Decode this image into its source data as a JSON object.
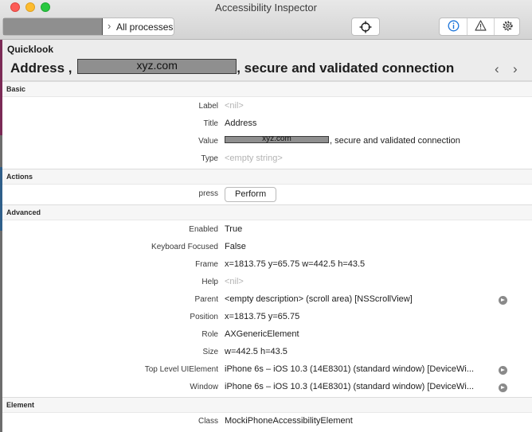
{
  "window": {
    "title": "Accessibility Inspector"
  },
  "toolbar": {
    "target_label": "All processes",
    "crosshair_icon": "crosshair-icon",
    "segments": [
      "info-icon",
      "warning-icon",
      "gear-icon"
    ]
  },
  "quicklook": {
    "heading": "Quicklook",
    "prefix": "Address ,",
    "redacted_text": "xyz.com",
    "suffix": ", secure and validated connection"
  },
  "sections": {
    "basic": "Basic",
    "actions": "Actions",
    "advanced": "Advanced",
    "element": "Element"
  },
  "basic": {
    "label_key": "Label",
    "label_val": "<nil>",
    "title_key": "Title",
    "title_val": "Address",
    "value_key": "Value",
    "value_redacted": "xyz.com",
    "value_suffix": ", secure and validated connection",
    "type_key": "Type",
    "type_val": "<empty string>"
  },
  "actions": {
    "press_key": "press",
    "perform_label": "Perform"
  },
  "advanced": {
    "enabled_key": "Enabled",
    "enabled_val": "True",
    "focused_key": "Keyboard Focused",
    "focused_val": "False",
    "frame_key": "Frame",
    "frame_val": "x=1813.75 y=65.75 w=442.5 h=43.5",
    "help_key": "Help",
    "help_val": "<nil>",
    "parent_key": "Parent",
    "parent_val": "<empty description> (scroll area) [NSScrollView]",
    "position_key": "Position",
    "position_val": "x=1813.75 y=65.75",
    "role_key": "Role",
    "role_val": "AXGenericElement",
    "size_key": "Size",
    "size_val": "w=442.5 h=43.5",
    "toplevel_key": "Top Level UIElement",
    "toplevel_val": "iPhone 6s – iOS 10.3 (14E8301) (standard window) [DeviceWi...",
    "window_key": "Window",
    "window_val": "iPhone 6s – iOS 10.3 (14E8301) (standard window) [DeviceWi..."
  },
  "element": {
    "class_key": "Class",
    "class_val": "MockiPhoneAccessibilityElement"
  }
}
